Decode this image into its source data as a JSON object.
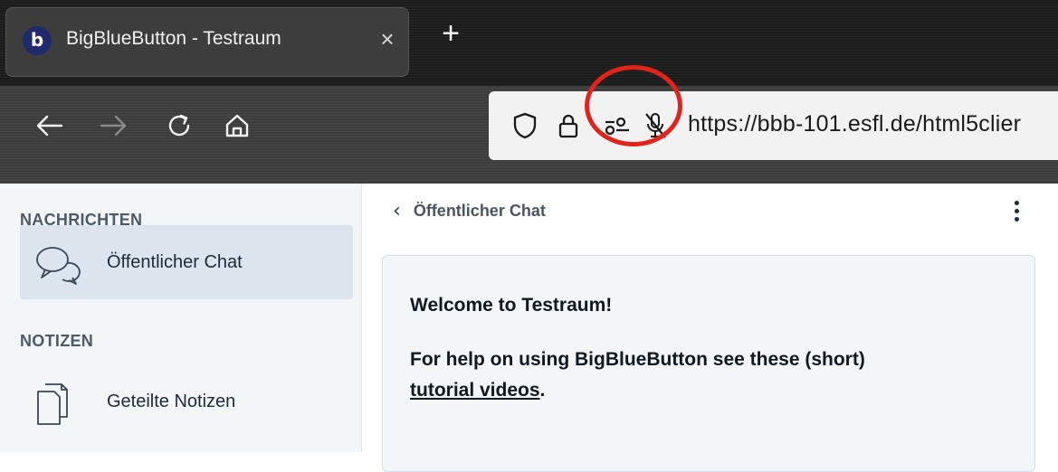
{
  "browser": {
    "tab": {
      "favicon": "b",
      "title": "BigBlueButton - Testraum",
      "close_glyph": "×"
    },
    "new_tab_glyph": "+",
    "nav": {
      "back_icon": "arrow-left-icon",
      "forward_icon": "arrow-right-icon",
      "reload_icon": "reload-icon",
      "home_icon": "home-icon"
    },
    "urlbar": {
      "url": "https://bbb-101.esfl.de/html5clier",
      "icons": [
        "shield-icon",
        "lock-icon",
        "permissions-icon",
        "microphone-muted-icon"
      ]
    },
    "highlight_color": "#e2231a"
  },
  "sidebar": {
    "messages_title": "NACHRICHTEN",
    "public_chat_label": "Öffentlicher Chat",
    "notes_title": "NOTIZEN",
    "shared_notes_label": "Geteilte Notizen"
  },
  "chat": {
    "back_glyph": "‹",
    "title": "Öffentlicher Chat",
    "welcome": {
      "line1": "Welcome to Testraum!",
      "line2": "For help on using BigBlueButton see these (short)",
      "link": "tutorial videos",
      "link_suffix": "."
    }
  }
}
